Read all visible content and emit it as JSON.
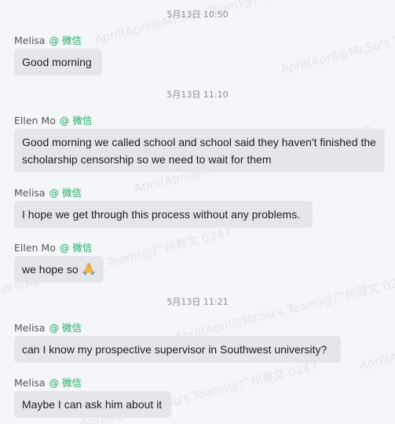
{
  "watermark": "April(April@Mr.Su's Team)@广州尊文 0247",
  "messages": [
    {
      "timestamp": "5月13日 10:50"
    },
    {
      "sender": "Melisa",
      "source": "@ 微信",
      "text": "Good morning"
    },
    {
      "timestamp": "5月13日 11:10"
    },
    {
      "sender": "Ellen Mo",
      "source": "@ 微信",
      "text": "Good morning we called school and school said they haven't finished the scholarship censorship so we need to wait for them"
    },
    {
      "sender": "Melisa",
      "source": "@ 微信",
      "text": "I hope we get through this process without any problems."
    },
    {
      "sender": "Ellen Mo",
      "source": "@ 微信",
      "text": "we hope so",
      "emoji": "folded-hands-icon"
    },
    {
      "timestamp": "5月13日 11:21"
    },
    {
      "sender": "Melisa",
      "source": "@ 微信",
      "text": "can I know my prospective supervisor in Southwest university?"
    },
    {
      "sender": "Melisa",
      "source": "@ 微信",
      "text": "Maybe I can ask him about it"
    }
  ],
  "colors": {
    "background": "#f5f6f9",
    "bubble": "#e4e6ea",
    "source_green": "#1aad5a",
    "timestamp": "#8c8c8c"
  }
}
